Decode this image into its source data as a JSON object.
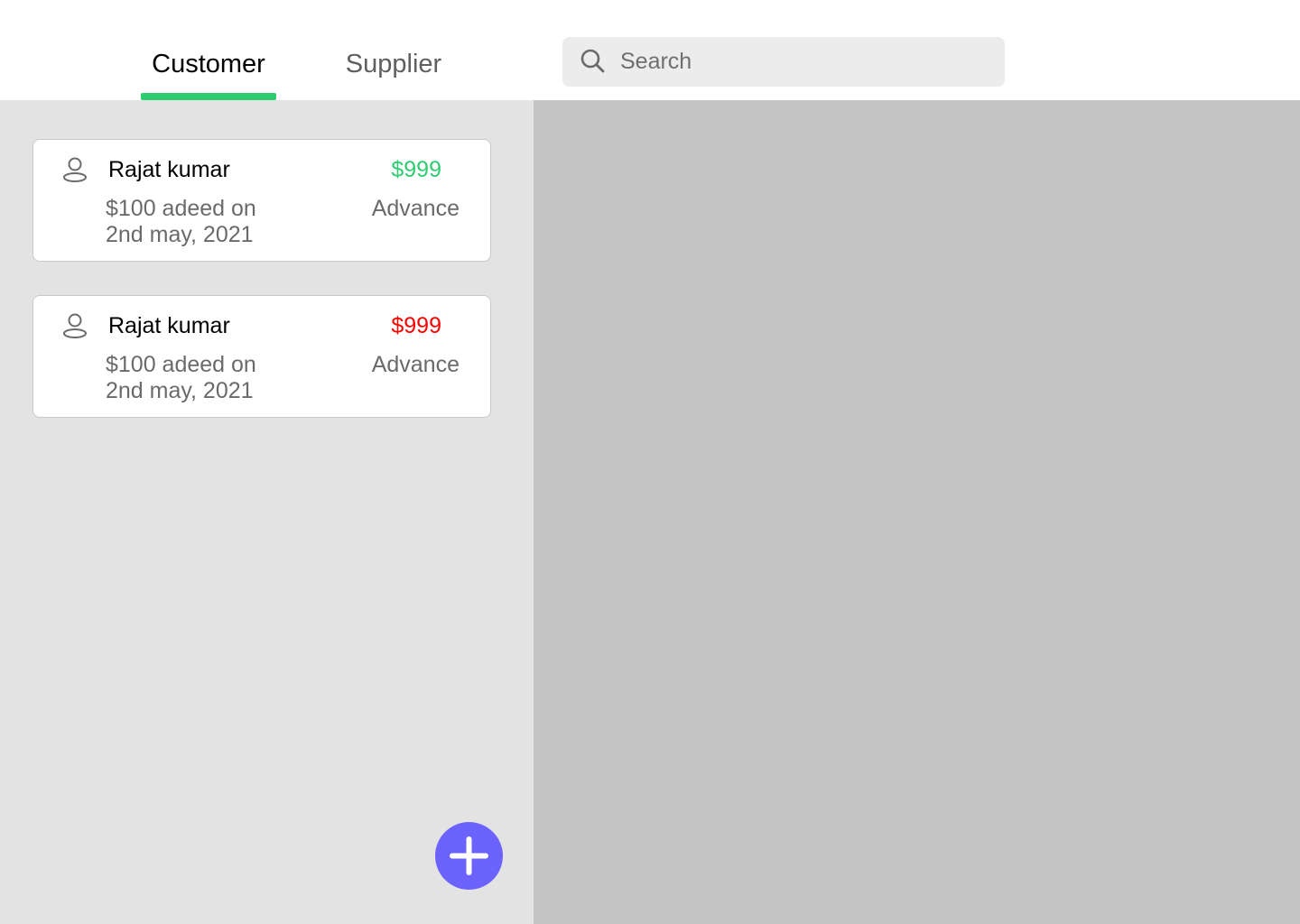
{
  "tabs": {
    "customer_label": "Customer",
    "supplier_label": "Supplier",
    "active": "Customer",
    "active_color": "#2ecc71"
  },
  "search": {
    "placeholder": "Search",
    "value": ""
  },
  "customers": [
    {
      "name": "Rajat kumar",
      "amount": "$999",
      "amount_color": "#2ecc71",
      "detail_line1": "$100 adeed on",
      "detail_line2": "2nd may, 2021",
      "status": "Advance"
    },
    {
      "name": "Rajat kumar",
      "amount": "$999",
      "amount_color": "#ff0000",
      "detail_line1": "$100 adeed on",
      "detail_line2": "2nd may, 2021",
      "status": "Advance"
    }
  ],
  "icons": {
    "search": "search-icon",
    "user": "user-icon",
    "add": "plus-icon"
  },
  "colors": {
    "fab": "#6c63ff",
    "left_panel_bg": "#e3e3e3",
    "right_panel_bg": "#c4c4c4"
  }
}
